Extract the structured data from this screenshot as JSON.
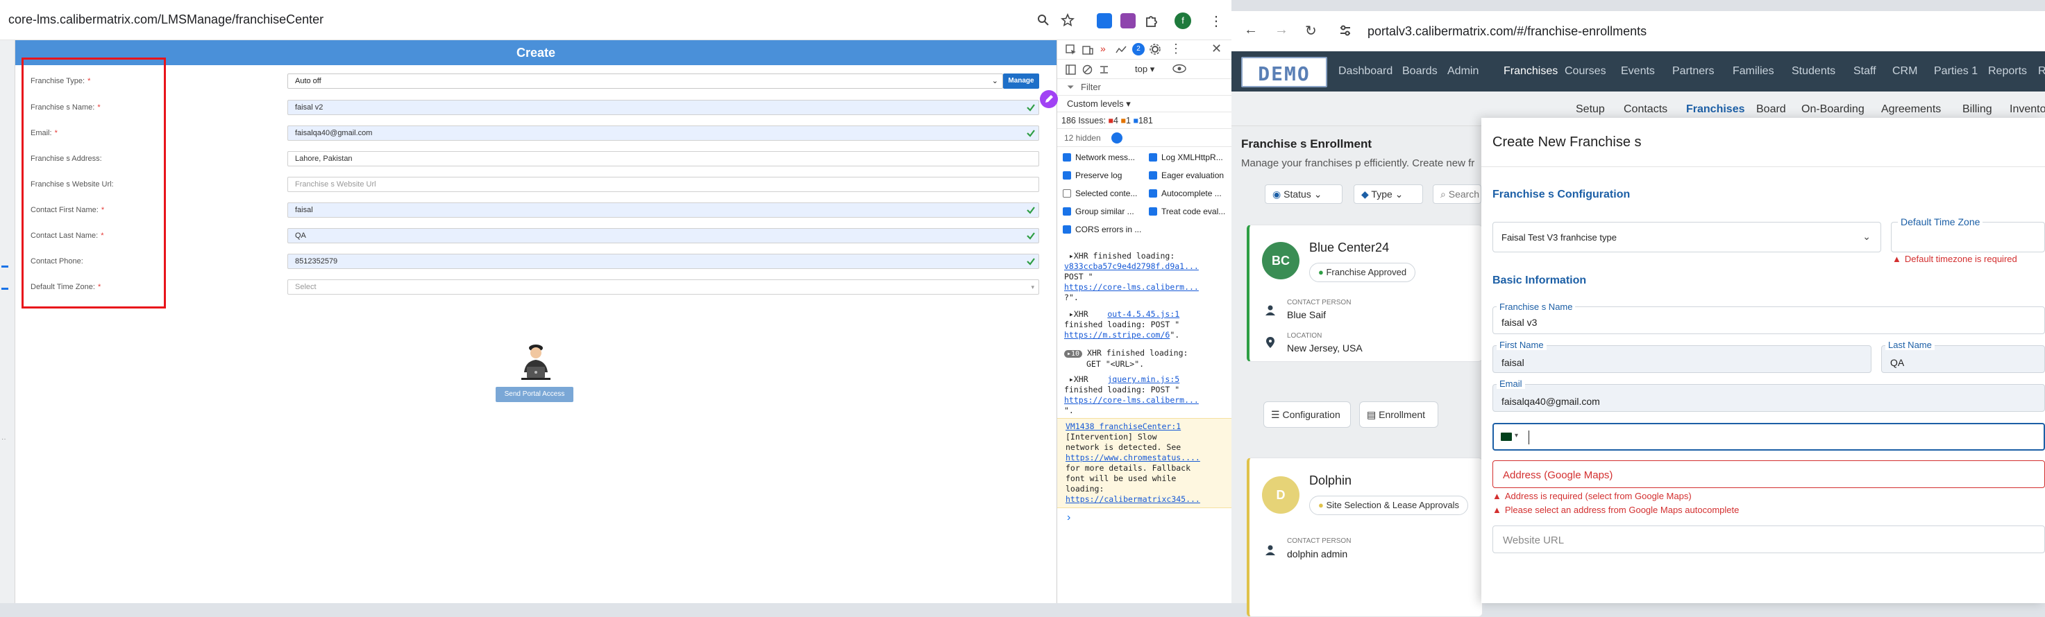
{
  "left_window": {
    "url": "core-lms.calibermatrix.com/LMSManage/franchiseCenter",
    "form_title": "Create",
    "fields": [
      {
        "label": "Franchise Type:",
        "required": true,
        "value": "Auto off",
        "type": "select",
        "valid": false
      },
      {
        "label": "Franchise s Name:",
        "required": true,
        "value": "faisal v2",
        "valid": true
      },
      {
        "label": "Email:",
        "required": true,
        "value": "faisalqa40@gmail.com",
        "valid": true
      },
      {
        "label": "Franchise s Address:",
        "required": false,
        "value": "Lahore, Pakistan",
        "valid": false
      },
      {
        "label": "Franchise s Website Url:",
        "required": false,
        "placeholder": "Franchise s Website Url",
        "valid": false
      },
      {
        "label": "Contact First Name:",
        "required": true,
        "value": "faisal",
        "valid": true
      },
      {
        "label": "Contact Last Name:",
        "required": true,
        "value": "QA",
        "valid": true
      },
      {
        "label": "Contact Phone:",
        "required": false,
        "value": "8512352579",
        "valid": true
      },
      {
        "label": "Default Time Zone:",
        "required": true,
        "placeholder": "Select",
        "type": "select",
        "valid": false
      }
    ],
    "manage_label": "Manage",
    "send_portal_label": "Send Portal Access"
  },
  "devtools": {
    "context": "top",
    "filter_placeholder": "Filter",
    "levels": "Custom levels",
    "issues_label": "186 Issues:",
    "issue_errors": "4",
    "issue_warnings": "1",
    "issue_info": "181",
    "hidden": "12 hidden",
    "options": [
      {
        "label": "Network mess...",
        "checked": true
      },
      {
        "label": "Log XMLHttpR...",
        "checked": true
      },
      {
        "label": "Preserve log",
        "checked": true
      },
      {
        "label": "Eager evaluation",
        "checked": true
      },
      {
        "label": "Selected conte...",
        "checked": false
      },
      {
        "label": "Autocomplete ...",
        "checked": true
      },
      {
        "label": "Group similar ...",
        "checked": true
      },
      {
        "label": "Treat code eval...",
        "checked": true
      },
      {
        "label": "CORS errors in ...",
        "checked": true
      }
    ],
    "logs": {
      "l1a": "XHR finished loading:",
      "l1b": "v833ccba57c9e4d2798f.d9a1...",
      "l1c": "POST \"",
      "l1d": "https://core-lms.caliberm...",
      "l1e": "?\".",
      "l2a": "XHR",
      "l2b": "out-4.5.45.js:1",
      "l2c": "finished loading: POST \"",
      "l2d": "https://m.stripe.com/6",
      "l2e": "\".",
      "l3count": "10",
      "l3a": "XHR finished loading:",
      "l3b": "GET \"<URL>\".",
      "l4a": "XHR",
      "l4b": "jquery.min.js:5",
      "l4c": "finished loading: POST \"",
      "l4d": "https://core-lms.caliberm...",
      "l4e": "\".",
      "w1": "VM1438 franchiseCenter:1",
      "w2": "[Intervention] Slow",
      "w3": "network is detected. See",
      "w4": "https://www.chromestatus....",
      "w5": "for more details. Fallback",
      "w6": "font will be used while",
      "w7": "loading:",
      "w8": "https://calibermatrixc345..."
    },
    "prompt": "›"
  },
  "right_window": {
    "url": "portalv3.calibermatrix.com/#/franchise-enrollments",
    "logo": "DEMO",
    "nav": [
      "Dashboard",
      "Boards",
      "Admin",
      "Franchises",
      "Courses",
      "Events",
      "Partners",
      "Families",
      "Students",
      "Staff",
      "CRM",
      "Parties 1",
      "Reports",
      "R"
    ],
    "nav_active": "Franchises",
    "subnav": [
      "Setup",
      "Contacts",
      "Franchises",
      "Board",
      "On-Boarding",
      "Agreements",
      "Billing",
      "Invento"
    ],
    "subnav_active": "Franchises",
    "page_title": "Franchise s Enrollment",
    "page_desc": "Manage your franchises p efficiently. Create new fr",
    "filters": {
      "status": "Status",
      "type": "Type",
      "search": "Search franch"
    },
    "cards": [
      {
        "initials": "BC",
        "name": "Blue Center24",
        "status": "Franchise Approved",
        "contact_label": "CONTACT PERSON",
        "contact": "Blue Saif",
        "location_label": "LOCATION",
        "location": "New Jersey, USA",
        "btn1": "Configuration",
        "btn2": "Enrollment"
      },
      {
        "initials": "D",
        "name": "Dolphin",
        "status": "Site Selection & Lease Approvals",
        "contact_label": "CONTACT PERSON",
        "contact": "dolphin admin"
      }
    ],
    "modal": {
      "title": "Create New Franchise s",
      "section1": "Franchise s Configuration",
      "franchise_type": "Faisal Test V3 franhcise type",
      "tz_label": "Default Time Zone",
      "tz_error": "Default timezone is required",
      "section2": "Basic Information",
      "name_label": "Franchise s Name",
      "name_value": "faisal v3",
      "first_label": "First Name",
      "first_value": "faisal",
      "last_label": "Last Name",
      "last_value": "QA",
      "email_label": "Email",
      "email_value": "faisalqa40@gmail.com",
      "address_placeholder": "Address (Google Maps)",
      "address_error1": "Address is required (select from Google Maps)",
      "address_error2": "Please select an address from Google Maps autocomplete",
      "website_placeholder": "Website URL"
    }
  }
}
